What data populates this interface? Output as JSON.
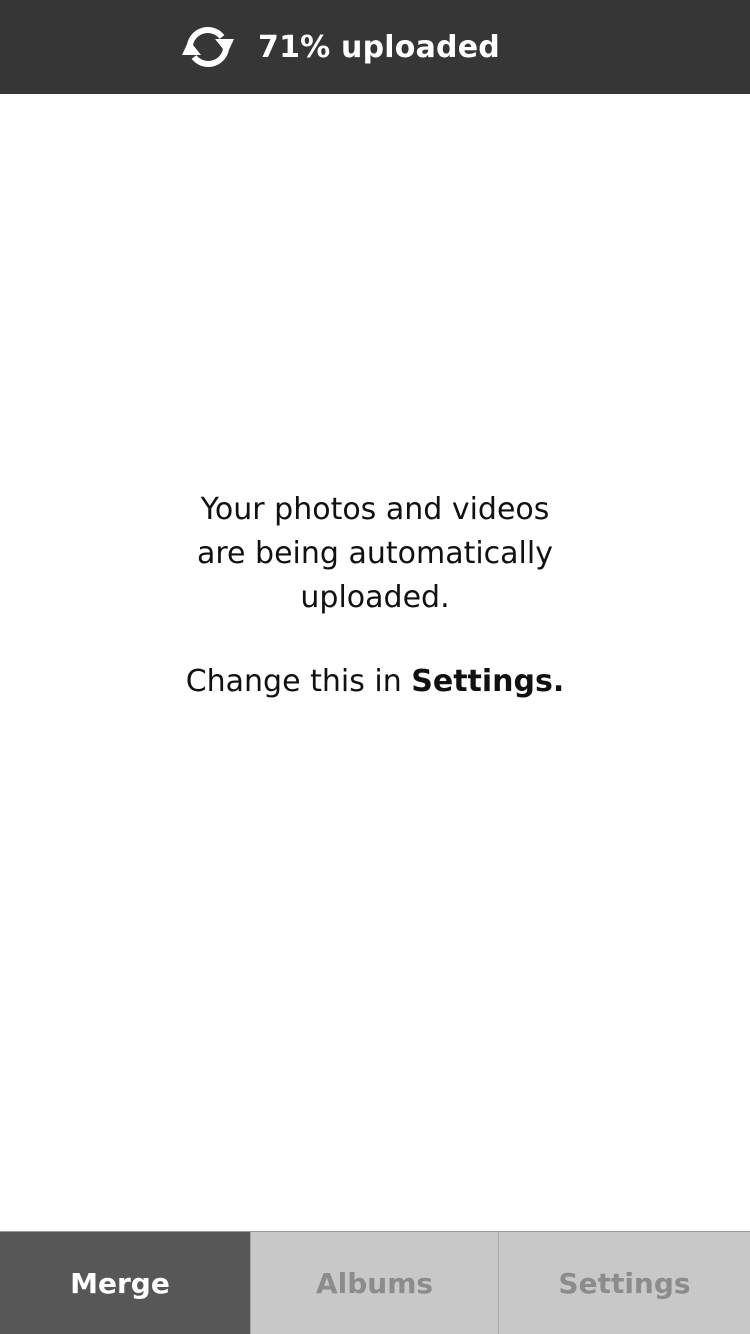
{
  "status_bar": {
    "icon": "sync-icon",
    "progress_percent": 71,
    "text": "71% uploaded",
    "background_color": "#363636"
  },
  "message": {
    "line1": "Your photos and videos",
    "line2": "are being automatically",
    "line3": "uploaded.",
    "settings_prefix": "Change this in ",
    "settings_link": "Settings."
  },
  "tabs": [
    {
      "label": "Merge",
      "active": true
    },
    {
      "label": "Albums",
      "active": false
    },
    {
      "label": "Settings",
      "active": false
    }
  ],
  "colors": {
    "active_tab": "#575757",
    "inactive_tab": "#c8c8c8",
    "inactive_tab_text": "#8c8c8c"
  }
}
